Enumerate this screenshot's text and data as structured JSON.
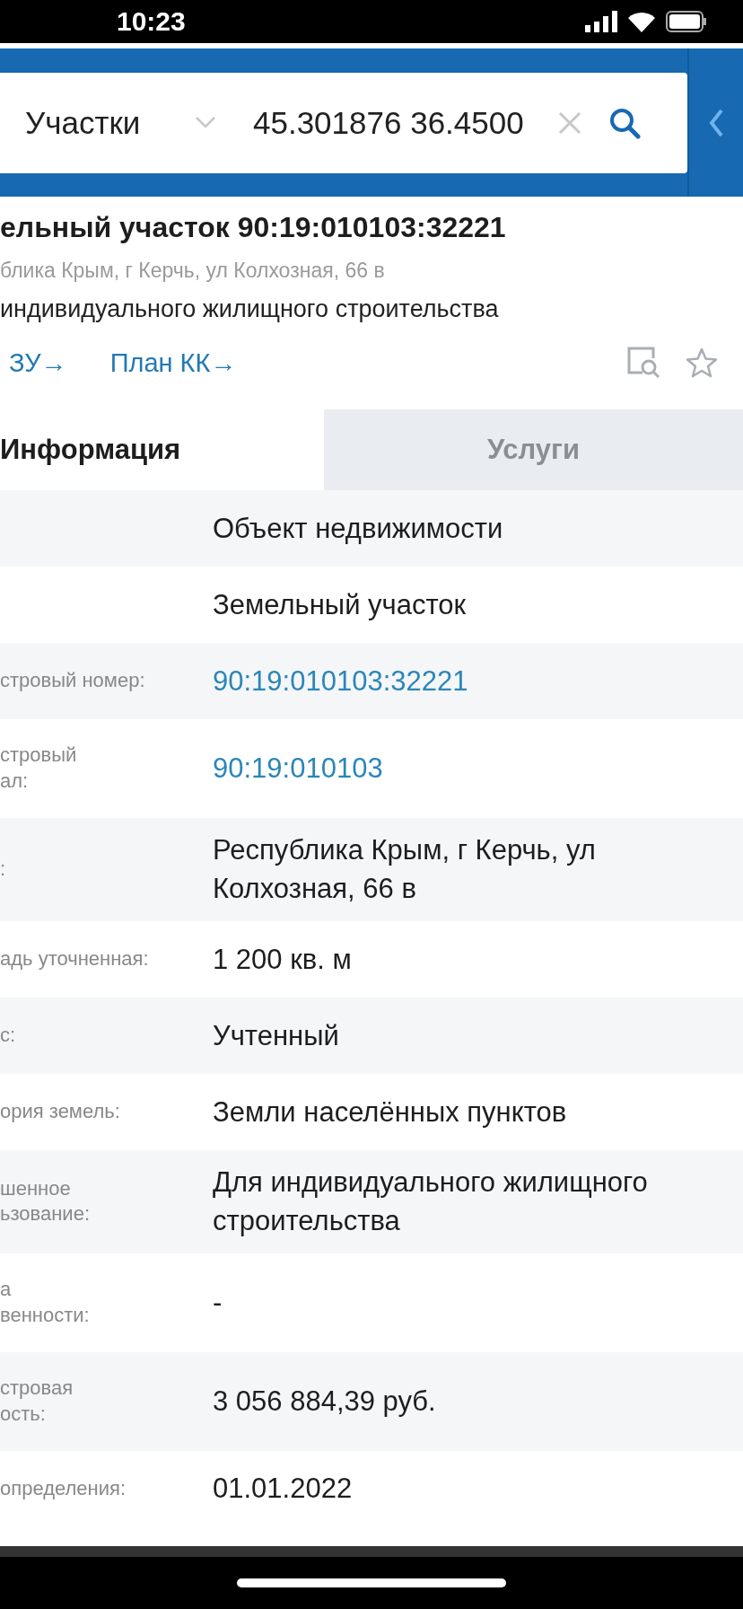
{
  "status_bar": {
    "time": "10:23"
  },
  "search": {
    "category": "Участки",
    "value": "45.301876 36.4500"
  },
  "header": {
    "title": "ельный участок 90:19:010103:32221",
    "address": "блика Крым, г Керчь, ул Колхозная, 66 в",
    "purpose": "индивидуального жилищного строительства",
    "links": [
      "ЗУ→",
      "План КК→"
    ]
  },
  "tabs": [
    {
      "label": "Информация",
      "selected": true
    },
    {
      "label": "Услуги",
      "selected": false
    }
  ],
  "rows": [
    {
      "label": "",
      "value": "Объект недвижимости",
      "kind": "text"
    },
    {
      "label": "",
      "value": "Земельный участок",
      "kind": "text"
    },
    {
      "label": "стровый номер:",
      "value": "90:19:010103:32221",
      "kind": "link"
    },
    {
      "label": "стровый\nал:",
      "value": "90:19:010103",
      "kind": "link"
    },
    {
      "label": ":",
      "value": "Республика Крым, г Керчь, ул Колхозная, 66 в",
      "kind": "text"
    },
    {
      "label": "адь уточненная:",
      "value": "1 200 кв. м",
      "kind": "text"
    },
    {
      "label": "с:",
      "value": "Учтенный",
      "kind": "text"
    },
    {
      "label": "ория земель:",
      "value": "Земли населённых пунктов",
      "kind": "text"
    },
    {
      "label": "шенное\nьзование:",
      "value": "Для индивидуального жилищного строительства",
      "kind": "text"
    },
    {
      "label": "а\nвенности:",
      "value": "-",
      "kind": "text"
    },
    {
      "label": "стровая\nость:",
      "value": "3 056 884,39 руб.",
      "kind": "text"
    },
    {
      "label": "определения:",
      "value": "01.01.2022",
      "kind": "text"
    }
  ]
}
